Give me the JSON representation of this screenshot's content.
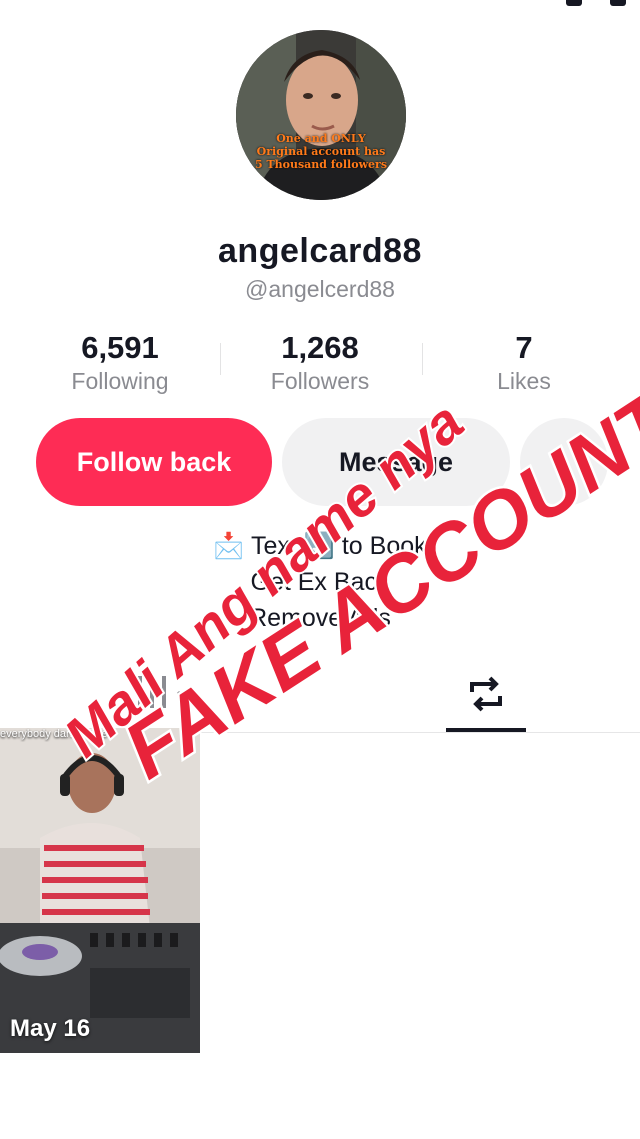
{
  "profile": {
    "display_name": "angelcard88",
    "handle": "@angelcerd88",
    "avatar_text": [
      "One and ONLY",
      "Original account has",
      "5 Thousand followers"
    ]
  },
  "stats": [
    {
      "value": "6,591",
      "label": "Following"
    },
    {
      "value": "1,268",
      "label": "Followers"
    },
    {
      "value": "7",
      "label": "Likes"
    }
  ],
  "actions": {
    "follow_back": "Follow back",
    "message": "Message"
  },
  "bio": {
    "line1": "📩 Text ⬇️ to Book",
    "line2": "Get Ex Back",
    "line3": "Remove Ads"
  },
  "tabs": {
    "videos_icon": "grid-icon",
    "reposts_icon": "repost-icon",
    "active": "reposts"
  },
  "video": {
    "date": "May 16",
    "caption": "everybody dance time"
  },
  "overlay": {
    "line1": "Mali Ang name nya",
    "line2": "FAKE ACCOUNT",
    "color": "#e8233a"
  }
}
